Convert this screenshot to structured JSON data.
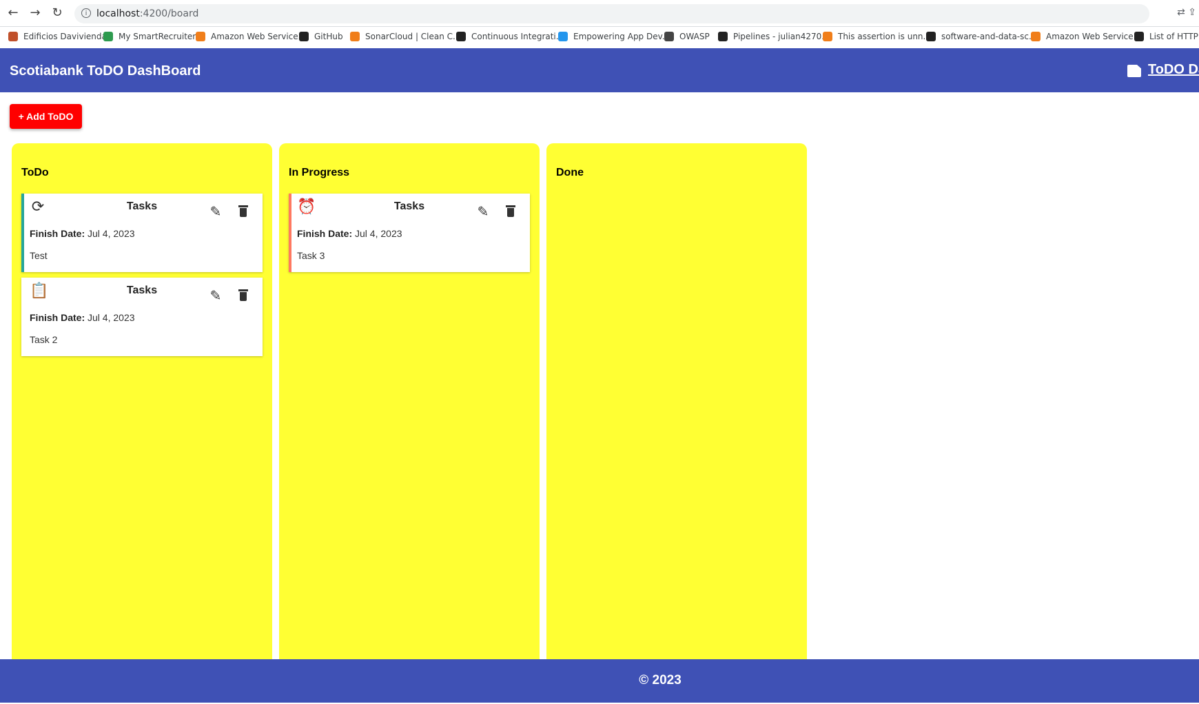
{
  "browser": {
    "url_host": "localhost",
    "url_rest": ":4200/board",
    "back_icon": "←",
    "forward_icon": "→",
    "reload_icon": "↻",
    "info_icon": "i",
    "right_icons": "⇄  ⇪",
    "bookmarks": [
      {
        "label": "Edificios Davivienda",
        "color": "#c0502a"
      },
      {
        "label": "My SmartRecruiters",
        "color": "#2e9b4f"
      },
      {
        "label": "Amazon Web Service...",
        "color": "#f07e1a"
      },
      {
        "label": "GitHub",
        "color": "#222222"
      },
      {
        "label": "SonarCloud | Clean C...",
        "color": "#f07e1a"
      },
      {
        "label": "Continuous Integrati...",
        "color": "#222222"
      },
      {
        "label": "Empowering App Dev...",
        "color": "#2496ed"
      },
      {
        "label": "OWASP",
        "color": "#444444"
      },
      {
        "label": "Pipelines - julian4270...",
        "color": "#222222"
      },
      {
        "label": "This assertion is unn...",
        "color": "#f07e1a"
      },
      {
        "label": "software-and-data-sc...",
        "color": "#222222"
      },
      {
        "label": "Amazon Web Service...",
        "color": "#f07e1a"
      },
      {
        "label": "List of HTTP st",
        "color": "#222222"
      }
    ]
  },
  "header": {
    "title": "Scotiabank ToDO DashBoard",
    "nav_label": "ToDO Da"
  },
  "toolbar": {
    "add_label": "+ Add ToDO"
  },
  "board": {
    "columns": [
      {
        "title": "ToDo",
        "cards": [
          {
            "title": "Tasks",
            "finish_label": "Finish Date:",
            "finish_date": "Jul 4, 2023",
            "description": "Test",
            "status_icon": "⟳",
            "accent": "#26a69a"
          },
          {
            "title": "Tasks",
            "finish_label": "Finish Date:",
            "finish_date": "Jul 4, 2023",
            "description": "Task 2",
            "status_icon": "📋",
            "accent": "#ffffff"
          }
        ]
      },
      {
        "title": "In Progress",
        "cards": [
          {
            "title": "Tasks",
            "finish_label": "Finish Date:",
            "finish_date": "Jul 4, 2023",
            "description": "Task 3",
            "status_icon": "⏰",
            "accent": "#ff7961"
          }
        ]
      },
      {
        "title": "Done",
        "cards": []
      }
    ],
    "edit_icon": "✎"
  },
  "footer": {
    "copyright": "© 2023"
  },
  "colors": {
    "primary": "#3f51b5",
    "column_bg": "#ffff33",
    "add_button": "#ff0000"
  }
}
